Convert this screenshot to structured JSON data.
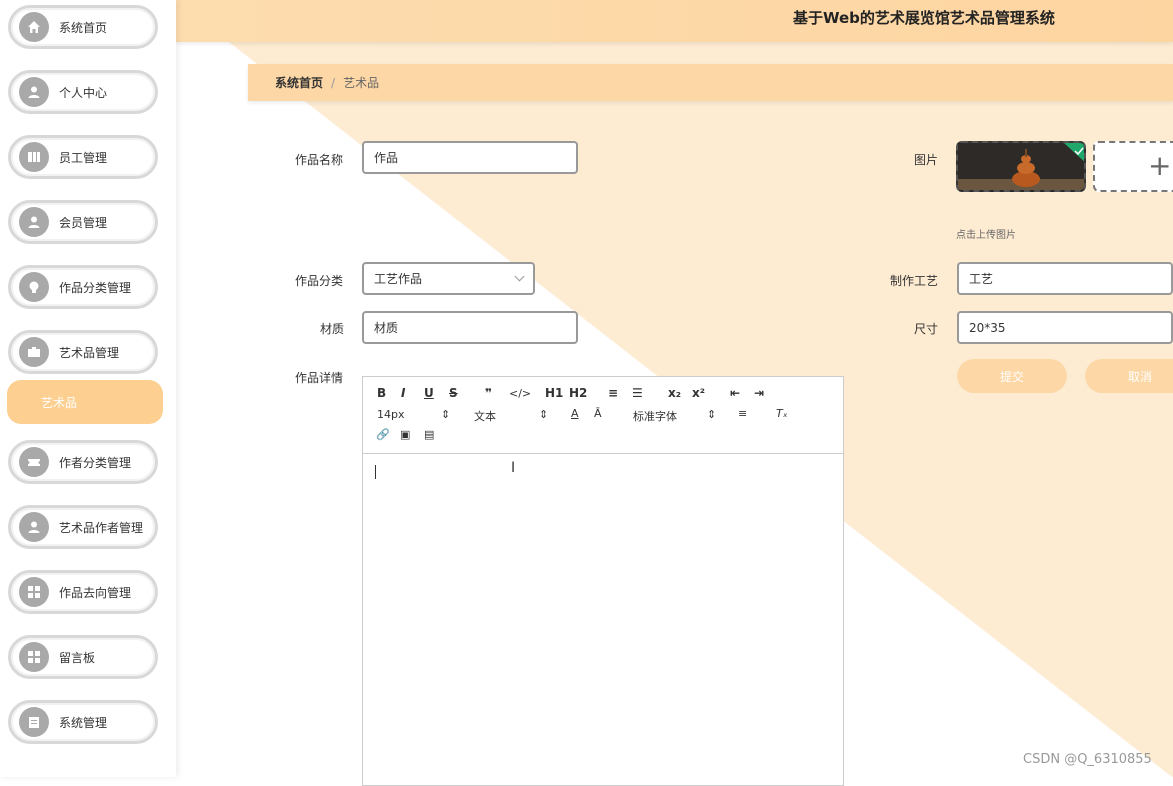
{
  "app_title": "基于Web的艺术展览馆艺术品管理系统",
  "breadcrumb": {
    "home": "系统首页",
    "separator": "/",
    "current": "艺术品"
  },
  "sidebar": {
    "items": [
      {
        "label": "系统首页",
        "icon": "home-icon"
      },
      {
        "label": "个人中心",
        "icon": "user-icon"
      },
      {
        "label": "员工管理",
        "icon": "book-icon"
      },
      {
        "label": "会员管理",
        "icon": "user-icon"
      },
      {
        "label": "作品分类管理",
        "icon": "bulb-icon"
      },
      {
        "label": "艺术品管理",
        "icon": "briefcase-icon"
      },
      {
        "label": "作者分类管理",
        "icon": "ticket-icon"
      },
      {
        "label": "艺术品作者管理",
        "icon": "user-icon"
      },
      {
        "label": "作品去向管理",
        "icon": "grid-icon"
      },
      {
        "label": "留言板",
        "icon": "grid-icon"
      },
      {
        "label": "系统管理",
        "icon": "clipboard-icon"
      }
    ],
    "active_sub": "艺术品"
  },
  "form": {
    "name": {
      "label": "作品名称",
      "value": "作品"
    },
    "image": {
      "label": "图片",
      "hint": "点击上传图片"
    },
    "category": {
      "label": "作品分类",
      "value": "工艺作品"
    },
    "craft": {
      "label": "制作工艺",
      "value": "工艺"
    },
    "material": {
      "label": "材质",
      "value": "材质"
    },
    "size": {
      "label": "尺寸",
      "value": "20*35"
    },
    "detail": {
      "label": "作品详情"
    }
  },
  "buttons": {
    "submit": "提交",
    "cancel": "取消"
  },
  "editor": {
    "toolbar_row1": [
      "B",
      "I",
      "U",
      "S",
      "❞",
      "</>",
      "H1",
      "H2",
      "≡",
      "☰",
      "x₂",
      "x²",
      "⇤",
      "⇥"
    ],
    "font_size": "14px",
    "text_type": "文本",
    "font_family": "标准字体"
  },
  "watermark": "CSDN @Q_6310855",
  "colors": {
    "accent": "#fdd7a6",
    "active": "#fdcf90",
    "icon_bg": "#a9a9a9"
  }
}
